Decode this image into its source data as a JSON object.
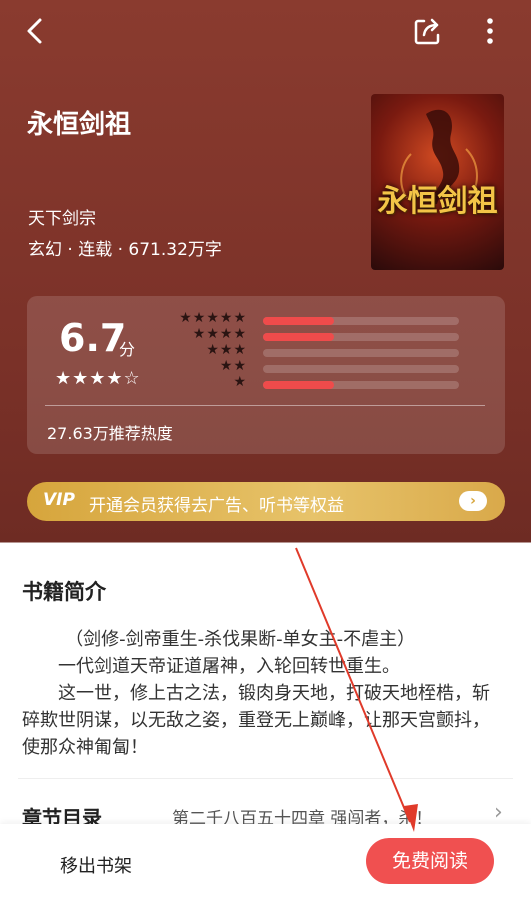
{
  "book": {
    "title": "永恒剑祖",
    "author": "天下剑宗",
    "meta": "玄幻 · 连载 · 671.32万字",
    "cover_text": "永恒剑祖"
  },
  "rating": {
    "score": "6.7",
    "unit": "分",
    "score_stars": "★★★★☆",
    "distribution": [
      {
        "stars": "★★★★★",
        "fraction": 0.36
      },
      {
        "stars": "★★★★",
        "fraction": 0.36
      },
      {
        "stars": "★★★",
        "fraction": 0.0
      },
      {
        "stars": "★★",
        "fraction": 0.0
      },
      {
        "stars": "★",
        "fraction": 0.36
      }
    ],
    "heat": "27.63万推荐热度"
  },
  "vip": {
    "badge": "VIP",
    "text": "开通会员获得去广告、听书等权益",
    "arrow": "›"
  },
  "intro": {
    "heading": "书籍简介",
    "paragraphs": [
      "（剑修-剑帝重生-杀伐果断-单女主-不虐主）",
      "一代剑道天帝证道屠神，入轮回转世重生。",
      "这一世，修上古之法，锻肉身天地，打破天地桎梏，斩碎欺世阴谋，以无敌之姿，重登无上巅峰，让那天宫颤抖，使那众神匍匐！"
    ]
  },
  "toc": {
    "label": "章节目录",
    "latest": "第二千八百五十四章 强闯者，杀！"
  },
  "actions": {
    "remove": "移出书架",
    "read": "免费阅读"
  },
  "colors": {
    "accent": "#f05050",
    "vip_gold": "#d6a53c",
    "header_bg": "#7a3128"
  }
}
